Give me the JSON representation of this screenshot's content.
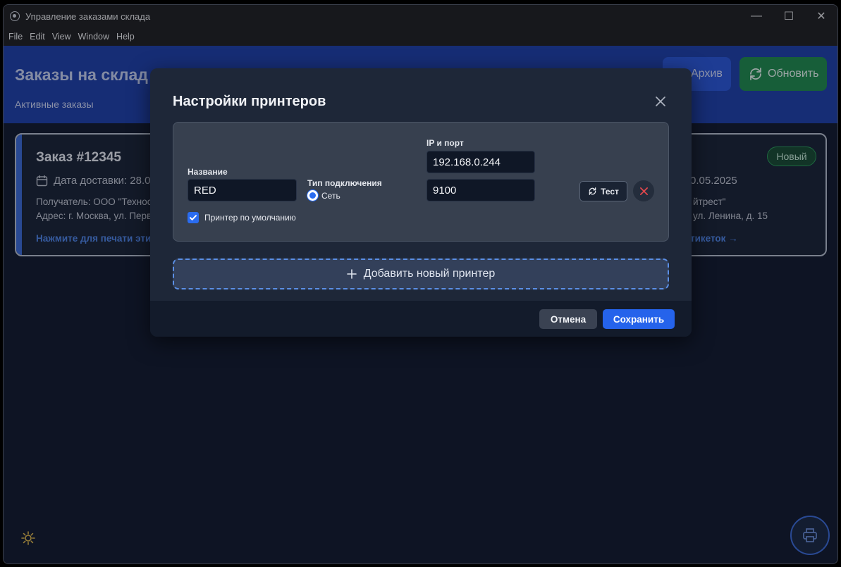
{
  "window": {
    "title": "Управление заказами склада",
    "controls": {
      "minimize": "—",
      "maximize": "☐",
      "close": "✕"
    }
  },
  "menu": [
    "File",
    "Edit",
    "View",
    "Window",
    "Help"
  ],
  "header": {
    "title": "Заказы на склад",
    "subtitle": "Активные заказы",
    "archive_label": "Архив",
    "refresh_label": "Обновить"
  },
  "order": {
    "title": "Заказ #12345",
    "date_left": "Дата доставки: 28.0",
    "date_right": "0.05.2025",
    "recipient_left": "Получатель: ООО \"Технос",
    "recipient_right": "йтрест\"",
    "address_left": "Адрес: г. Москва, ул. Перв",
    "address_right": "ул. Ленина, д. 15",
    "print_left": "Нажмите для печати эти",
    "print_right": "тикеток →",
    "status": "Новый"
  },
  "modal": {
    "title": "Настройки принтеров",
    "printer": {
      "name_label": "Название",
      "name_value": "RED",
      "connection_label": "Тип подключения",
      "connection_option": "Сеть",
      "ip_label": "IP и порт",
      "ip_value": "192.168.0.244",
      "port_value": "9100",
      "default_label": "Принтер по умолчанию",
      "default_checked": true,
      "test_label": "Тест"
    },
    "add_printer_label": "Добавить новый принтер",
    "cancel_label": "Отмена",
    "save_label": "Сохранить"
  },
  "colors": {
    "header_bg": "#1e3fa8",
    "refresh_bg": "#1f8a4c",
    "accent": "#2563eb",
    "status_green": "#2a9a57",
    "delete_red": "#e5484d"
  },
  "icons": [
    "app-icon",
    "calendar-icon",
    "archive-icon",
    "refresh-icon",
    "close-icon",
    "check-icon",
    "plus-icon",
    "sun-icon",
    "printer-icon"
  ]
}
